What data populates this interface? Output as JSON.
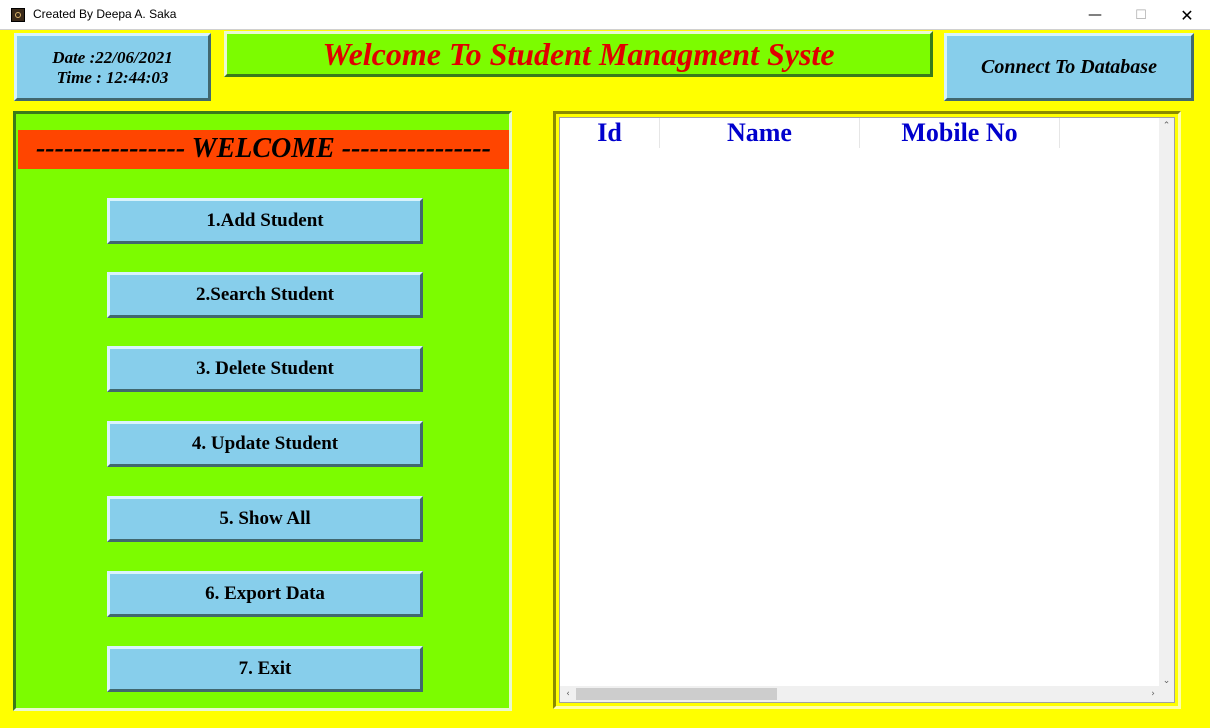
{
  "window": {
    "title": "Created By Deepa A. Saka",
    "minimize_glyph": "—",
    "maximize_glyph": "☐",
    "close_glyph": "✕"
  },
  "header": {
    "date_text": "Date :22/06/2021",
    "time_text": "Time : 12:44:03",
    "banner_text": "Welcome To Student Managment Syste",
    "connect_label": "Connect To Database"
  },
  "menu": {
    "welcome_text": "---------------- WELCOME ----------------",
    "buttons": [
      "1.Add Student",
      "2.Search Student",
      "3. Delete Student",
      "4. Update Student",
      "5. Show All",
      "6. Export Data",
      "7. Exit"
    ]
  },
  "table": {
    "columns": [
      "Id",
      "Name",
      "Mobile No"
    ],
    "rows": [],
    "scroll_up": "⌃",
    "scroll_down": "⌄",
    "scroll_left": "‹",
    "scroll_right": "›"
  },
  "colors": {
    "background": "#ffff00",
    "panel_green": "#7cfc00",
    "button_blue": "#87ceeb",
    "welcome_bar": "#ff4500",
    "banner_text": "#e00000",
    "column_header_text": "#0000cd"
  }
}
